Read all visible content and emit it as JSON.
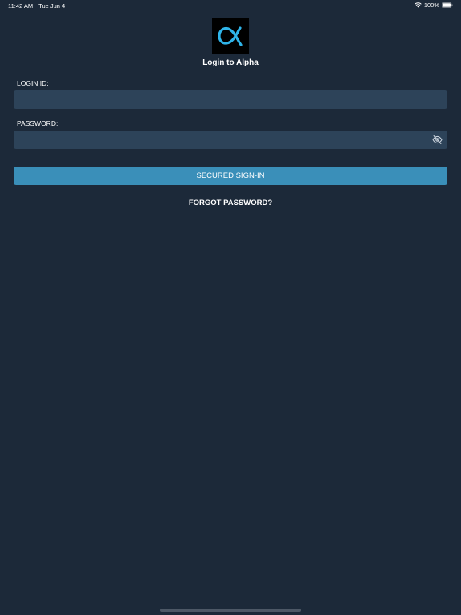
{
  "status_bar": {
    "time": "11:42 AM",
    "date": "Tue Jun 4",
    "battery_percent": "100%",
    "icons": [
      "wifi-icon",
      "battery-icon"
    ]
  },
  "logo": {
    "icon": "alpha-logo-icon",
    "symbol": "∝",
    "background": "#000000",
    "glyph_color": "#2fb4e9"
  },
  "title": "Login to Alpha",
  "login_id": {
    "label": "LOGIN ID:",
    "value": "",
    "placeholder": ""
  },
  "password": {
    "label": "PASSWORD:",
    "value": "",
    "placeholder": "",
    "toggle_icon": "eye-slash-icon"
  },
  "signin_button": {
    "label": "SECURED SIGN-IN"
  },
  "forgot_password": {
    "label": "FORGOT PASSWORD?"
  },
  "colors": {
    "background": "#1c2939",
    "input_background": "#2d4359",
    "button_background": "#3a8fb9",
    "text": "#ffffff"
  }
}
